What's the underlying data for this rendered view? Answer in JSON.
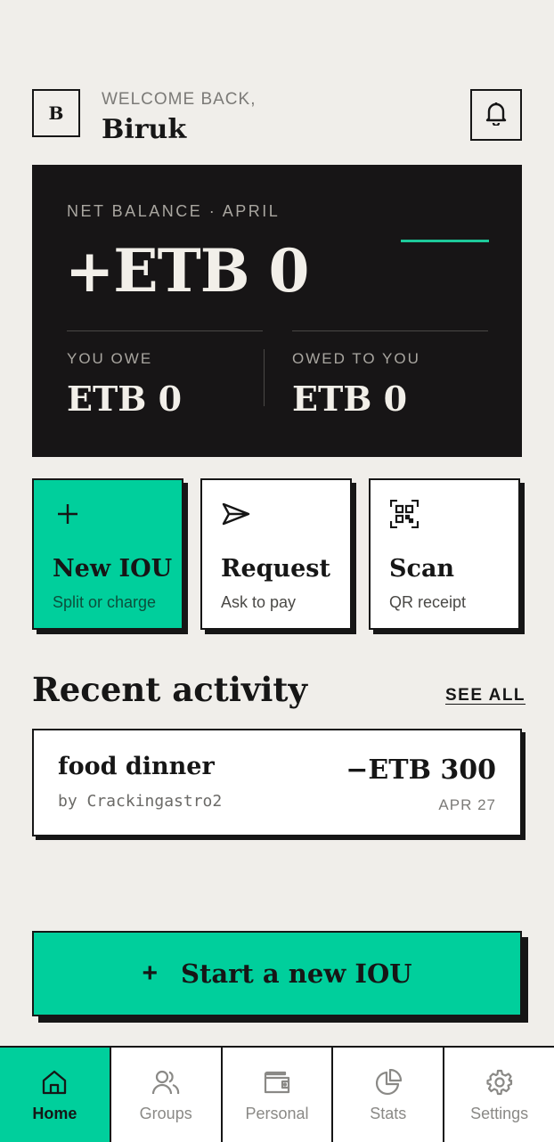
{
  "header": {
    "avatar_initial": "B",
    "welcome": "WELCOME BACK,",
    "username": "Biruk"
  },
  "balance": {
    "label": "NET BALANCE · APRIL",
    "amount": "+ETB 0",
    "you_owe_label": "YOU OWE",
    "you_owe_amount": "ETB 0",
    "owed_to_you_label": "OWED TO YOU",
    "owed_to_you_amount": "ETB 0"
  },
  "actions": [
    {
      "title": "New IOU",
      "subtitle": "Split or charge",
      "icon": "plus-icon"
    },
    {
      "title": "Request",
      "subtitle": "Ask to pay",
      "icon": "send-icon"
    },
    {
      "title": "Scan",
      "subtitle": "QR receipt",
      "icon": "qr-code-icon"
    }
  ],
  "recent": {
    "title": "Recent activity",
    "see_all": "SEE ALL",
    "items": [
      {
        "title": "food dinner",
        "by": "by Crackingastro2",
        "amount": "−ETB 300",
        "date": "APR 27"
      }
    ]
  },
  "cta": {
    "label": "Start a new IOU",
    "plus": "+"
  },
  "nav": [
    {
      "label": "Home",
      "icon": "home-icon",
      "active": true
    },
    {
      "label": "Groups",
      "icon": "users-icon",
      "active": false
    },
    {
      "label": "Personal",
      "icon": "wallet-icon",
      "active": false
    },
    {
      "label": "Stats",
      "icon": "pie-chart-icon",
      "active": false
    },
    {
      "label": "Settings",
      "icon": "gear-icon",
      "active": false
    }
  ],
  "colors": {
    "accent": "#00cf9c",
    "card": "#171516",
    "background": "#f0eeea",
    "ink": "#161616"
  }
}
